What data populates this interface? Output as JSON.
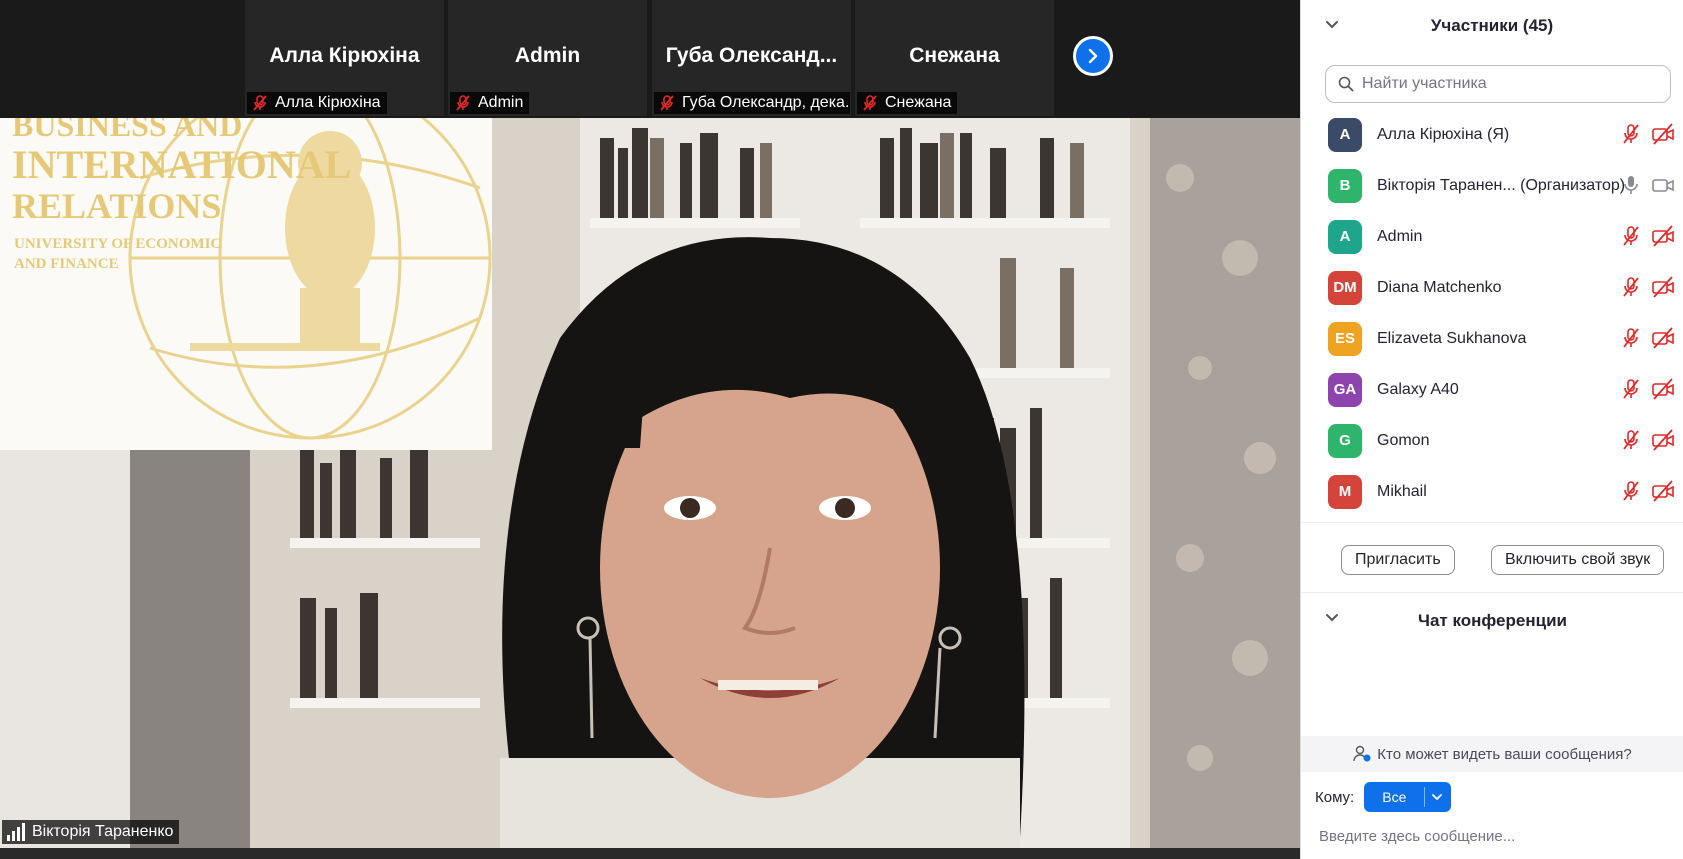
{
  "thumbnails": [
    {
      "name": "Алла Кірюхіна",
      "label": "Алла Кірюхіна"
    },
    {
      "name": "Admin",
      "label": "Admin"
    },
    {
      "name": "Губа Олександ...",
      "label": "Губа Олександр, дека..."
    },
    {
      "name": "Снежана",
      "label": "Снежана"
    }
  ],
  "speaker": {
    "label": "Вікторія Тараненко",
    "logo_lines": [
      "BUSINESS AND",
      "INTERNATIONAL",
      "RELATIONS",
      "UNIVERSITY OF ECONOMIC",
      "AND FINANCE"
    ]
  },
  "participants_panel": {
    "title": "Участники (45)",
    "search_placeholder": "Найти участника",
    "participants": [
      {
        "initials": "A",
        "name": "Алла Кірюхіна (Я)",
        "color": "#3b4a66",
        "mic": "muted",
        "video": "off"
      },
      {
        "initials": "B",
        "name": "Вікторія Таранен... (Организатор)",
        "color": "#2eb56b",
        "mic": "on",
        "video": "on"
      },
      {
        "initials": "A",
        "name": "Admin",
        "color": "#1fa58c",
        "mic": "muted",
        "video": "off"
      },
      {
        "initials": "DM",
        "name": "Diana Matchenko",
        "color": "#d5443b",
        "mic": "muted",
        "video": "off"
      },
      {
        "initials": "ES",
        "name": "Elizaveta Sukhanova",
        "color": "#eea322",
        "mic": "muted",
        "video": "off"
      },
      {
        "initials": "GA",
        "name": "Galaxy A40",
        "color": "#8e44ad",
        "mic": "muted",
        "video": "off"
      },
      {
        "initials": "G",
        "name": "Gomon",
        "color": "#2eb56b",
        "mic": "muted",
        "video": "off"
      },
      {
        "initials": "M",
        "name": "Mikhail",
        "color": "#d5443b",
        "mic": "muted",
        "video": "off"
      }
    ],
    "invite_label": "Пригласить",
    "unmute_label": "Включить свой звук"
  },
  "chat_panel": {
    "title": "Чат конференции",
    "visibility_text": "Кто может видеть ваши сообщения?",
    "to_label": "Кому:",
    "recipient": "Все",
    "message_placeholder": "Введите здесь сообщение..."
  },
  "colors": {
    "accent": "#0e71eb",
    "muted_red": "#e02828"
  }
}
